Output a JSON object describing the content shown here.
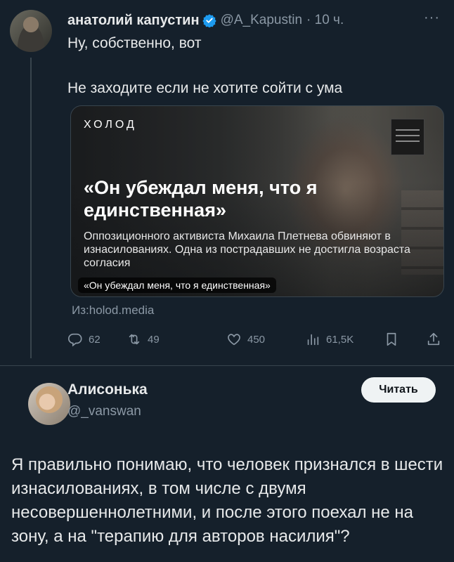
{
  "tweet1": {
    "author_name": "анатолий капустин",
    "handle": "@A_Kapustin",
    "time": "· 10 ч.",
    "more": "···",
    "text_line1": "Ну, собственно, вот",
    "text_line2": "Не заходите если не хотите сойти с ума",
    "card": {
      "outlet": "ХОЛОД",
      "title": "«Он убеждал меня, что я единственная»",
      "subtitle": "Оппозиционного активиста Михаила Плетнева обвиняют в изнасилованиях. Одна из пострадавших не достигла возраста согласия",
      "caption": "«Он убеждал меня, что я единственная»"
    },
    "source": "Из:holod.media",
    "actions": {
      "replies": "62",
      "retweets": "49",
      "likes": "450",
      "views": "61,5K"
    }
  },
  "tweet2": {
    "author_name": "Алисонька",
    "handle": "@_vanswan",
    "follow_label": "Читать",
    "text": "Я правильно понимаю, что человек признался в шести изнасилованиях, в том числе с двумя несовершеннолетними, и после этого поехал не на зону, а на \"терапию для авторов насилия\"?"
  },
  "colors": {
    "background": "#15202b",
    "text": "#e7e9ea",
    "muted": "#8b98a5",
    "verified": "#1d9bf0",
    "divider": "#38444d"
  },
  "icons": [
    "verified-badge-icon",
    "reply-icon",
    "retweet-icon",
    "like-icon",
    "views-icon",
    "bookmark-icon",
    "share-icon"
  ]
}
